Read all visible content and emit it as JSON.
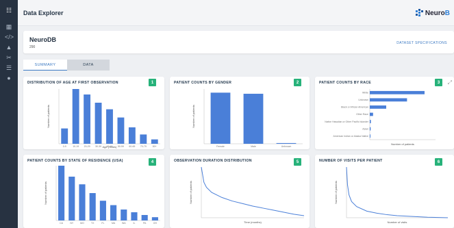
{
  "header": {
    "title": "Data Explorer",
    "logo_text_a": "Neuro",
    "logo_text_b": "B"
  },
  "dataset": {
    "name": "NeuroDB",
    "count": "290",
    "specs_label": "DATASET SPECIFICATIONS"
  },
  "tabs": [
    {
      "label": "SUMMARY"
    },
    {
      "label": "DATA"
    }
  ],
  "sidebar_icons": [
    "dashboard-icon",
    "code-icon",
    "chart-icon",
    "cut-icon",
    "layers-icon",
    "user-icon"
  ],
  "cards": [
    {
      "title": "DISTRIBUTION OF AGE AT FIRST OBSERVATION",
      "badge": "1"
    },
    {
      "title": "PATIENT COUNTS BY GENDER",
      "badge": "2"
    },
    {
      "title": "PATIENT COUNTS BY RACE",
      "badge": "3"
    },
    {
      "title": "PATIENT COUNTS BY STATE OF RESIDENCE (USA)",
      "badge": "4"
    },
    {
      "title": "OBSERVATION DURATION DISTRIBUTION",
      "badge": "5"
    },
    {
      "title": "NUMBER OF VISITS PER PATIENT",
      "badge": "6"
    }
  ],
  "colors": {
    "bar": "#4a7fd8",
    "badge": "#27b27a",
    "accent": "#3a78c2"
  },
  "chart_data": [
    {
      "type": "bar",
      "title": "DISTRIBUTION OF AGE AT FIRST OBSERVATION",
      "xlabel": "Age (Years)",
      "ylabel": "Number of patients",
      "categories": [
        "0-9",
        "10-19",
        "20-29",
        "30-39",
        "40-49",
        "50-59",
        "60-69",
        "70-79",
        "80+"
      ],
      "values": [
        28,
        100,
        90,
        75,
        63,
        48,
        30,
        17,
        8
      ],
      "ylim": [
        0,
        100
      ]
    },
    {
      "type": "bar",
      "title": "PATIENT COUNTS BY GENDER",
      "xlabel": "",
      "ylabel": "Number of patients",
      "categories": [
        "Female",
        "Male",
        "Unknown"
      ],
      "values": [
        140,
        137,
        2
      ],
      "ylim": [
        0,
        150
      ]
    },
    {
      "type": "bar",
      "orientation": "horizontal",
      "title": "PATIENT COUNTS BY RACE",
      "xlabel": "Number of patients",
      "ylabel": "",
      "categories": [
        "White",
        "Unknown",
        "Black or African American",
        "Other Race",
        "Native Hawaiian or Other Pacific Islander",
        "Asian",
        "American Indian or Alaska Native"
      ],
      "values": [
        250,
        170,
        75,
        15,
        5,
        4,
        3
      ],
      "xlim": [
        0,
        300
      ]
    },
    {
      "type": "bar",
      "title": "PATIENT COUNTS BY STATE OF RESIDENCE (USA)",
      "xlabel": "",
      "ylabel": "Number of patients",
      "categories": [
        "CA",
        "NY",
        "MO",
        "TX",
        "FL",
        "MA",
        "WA",
        "IL",
        "PA",
        "OH"
      ],
      "values": [
        100,
        80,
        66,
        50,
        36,
        28,
        20,
        15,
        10,
        6
      ],
      "ylim": [
        0,
        100
      ]
    },
    {
      "type": "line",
      "title": "OBSERVATION DURATION DISTRIBUTION",
      "xlabel": "Time (months)",
      "ylabel": "Number of patients",
      "x": [
        0,
        5,
        10,
        20,
        40,
        60,
        80,
        100,
        120,
        140,
        160,
        180,
        200
      ],
      "y": [
        100,
        70,
        60,
        50,
        40,
        33,
        28,
        23,
        19,
        15,
        11,
        7,
        4
      ],
      "ylim": [
        0,
        100
      ],
      "xlim": [
        0,
        200
      ]
    },
    {
      "type": "line",
      "title": "NUMBER OF VISITS PER PATIENT",
      "xlabel": "Number of visits",
      "ylabel": "Number of patients",
      "x": [
        0,
        2,
        5,
        10,
        20,
        40,
        60,
        80,
        100,
        120,
        140,
        160,
        200
      ],
      "y": [
        100,
        65,
        45,
        32,
        22,
        13,
        9,
        6,
        4,
        3,
        2,
        1,
        0
      ],
      "ylim": [
        0,
        100
      ],
      "xlim": [
        0,
        200
      ]
    }
  ]
}
